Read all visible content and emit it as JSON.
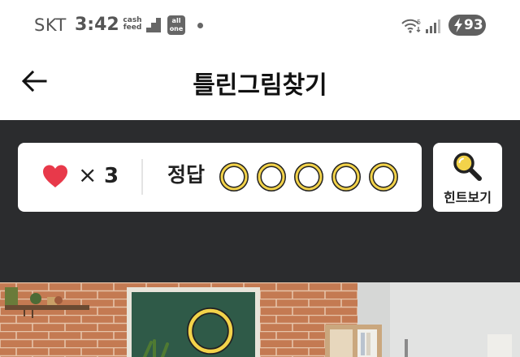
{
  "status_bar": {
    "carrier": "SKT",
    "time": "3:42",
    "app_badge_cash_line1": "cash",
    "app_badge_cash_line2": "feed",
    "app_badge_allone_line1": "all",
    "app_badge_allone_line2": "one",
    "network_badge": "5",
    "battery": "93",
    "icons": [
      "cashfeed-icon",
      "stairs-icon",
      "allone-icon",
      "notification-dot-icon",
      "wifi-icon",
      "signal-icon",
      "battery-charging-icon"
    ]
  },
  "header": {
    "title": "틀린그림찾기",
    "back_icon": "arrow-left-icon"
  },
  "status_card": {
    "heart_icon": "heart-icon",
    "lives_multiplier": "×",
    "lives": "3",
    "answer_label": "정답",
    "answers_total": 5,
    "answers_found": 0
  },
  "hint_button": {
    "label": "힌트보기",
    "icon": "magnifier-icon"
  },
  "colors": {
    "game_background": "#2b2c2e",
    "slot_ring": "#f3d34a",
    "heart": "#e8394a",
    "hint_accent": "#f3d34a"
  }
}
